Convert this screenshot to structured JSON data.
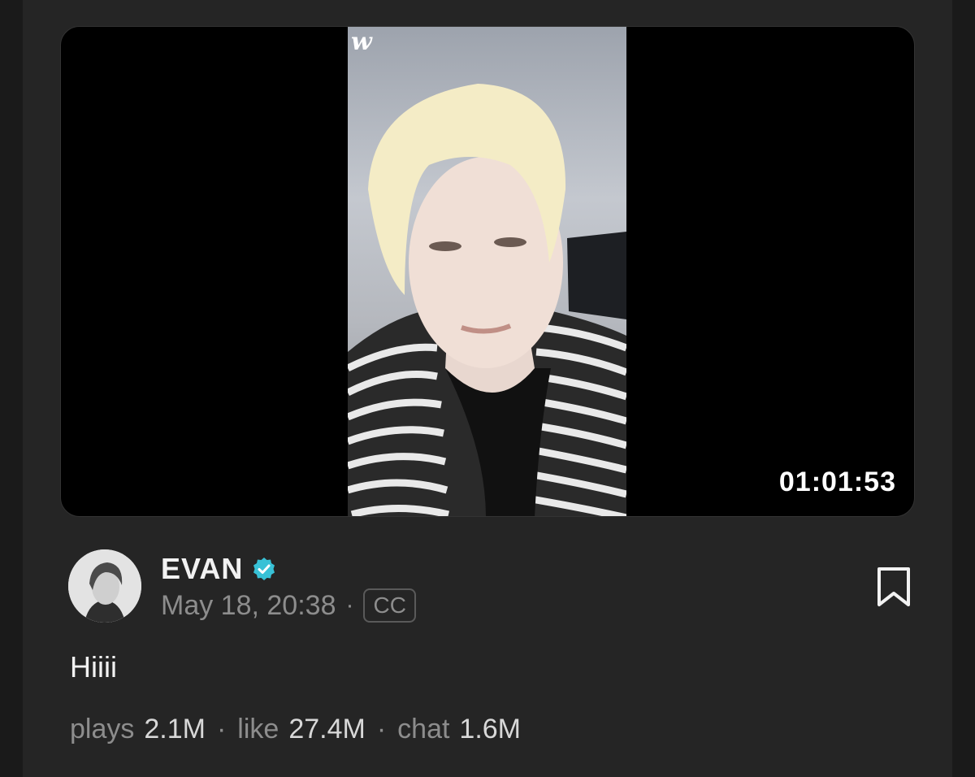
{
  "video": {
    "duration": "01:01:53",
    "logo_icon": "weverse-logo-icon"
  },
  "post": {
    "author": "EVAN",
    "verified_icon": "verified-badge-icon",
    "date": "May 18, 20:38",
    "separator": "·",
    "cc_label": "CC",
    "caption": "Hiiii",
    "bookmark_icon": "bookmark-icon"
  },
  "stats": [
    {
      "label": "plays",
      "value": "2.1M"
    },
    {
      "label": "like",
      "value": "27.4M"
    },
    {
      "label": "chat",
      "value": "1.6M"
    }
  ],
  "colors": {
    "background": "#252525",
    "verified": "#38c1d6",
    "muted_text": "#8d8d8d",
    "primary_text": "#f2f2f2"
  }
}
